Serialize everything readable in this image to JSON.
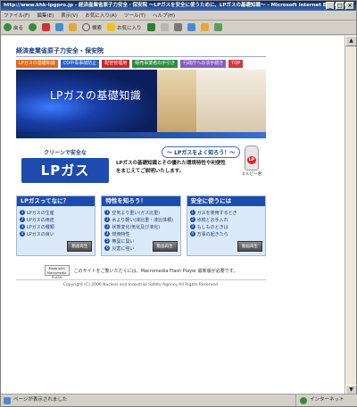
{
  "window": {
    "title": "http://www.khk-lpgpro.jp - 経済産業省原子力安全・保安院 ～LPガスを安全に使うために、LPガスの基礎知識～ - Microsoft Internet Explorer",
    "controls": [
      "_",
      "□",
      "×"
    ]
  },
  "menubar": [
    "ファイル(F)",
    "編集(E)",
    "表示(V)",
    "お気に入り(A)",
    "ツール(T)",
    "ヘルプ(H)"
  ],
  "toolbar": {
    "back": "戻る",
    "search": "検索",
    "favorites": "お気に入り"
  },
  "page": {
    "org": "経済産業省原子力安全・保安院",
    "nav": [
      {
        "label": "LPガスの基礎知識",
        "color": "#e06a1a"
      },
      {
        "label": "CO中毒事故防止",
        "color": "#2a62c9"
      },
      {
        "label": "配管管理用",
        "color": "#c62828"
      },
      {
        "label": "販売事業者の手引き",
        "color": "#2e8b3d"
      },
      {
        "label": "行政庁への法手続き",
        "color": "#8a5cc1"
      },
      {
        "label": "TOP",
        "color": "#d33a3a"
      }
    ],
    "banner_title": "LPガスの基礎知識",
    "logo_sub": "クリーンで安全な",
    "logo_main": "LPガス",
    "bubble": "～ LPガスをよく知ろう！～",
    "intro": "LPガスの基礎知識とその優れた環境特性や利便性をまじえてご説明いたします。",
    "mascot_badge": "LP",
    "mascot_name": "エルピー君",
    "sections": [
      {
        "title": "LPガスってなに？",
        "items": [
          "LPガスの生産",
          "LPガスの用途",
          "LPガスの種類",
          "LPガスの良い"
        ],
        "button": "動画再生"
      },
      {
        "title": "特性を知ろう！",
        "items": [
          "空気より重い(ガス比重)",
          "水より軽い(液比重・液比体積)",
          "状態変化(気化及び液化)",
          "燃焼特性",
          "無臭に臭い",
          "災害に強い"
        ],
        "button": "動画再生"
      },
      {
        "title": "安全に使うには",
        "items": [
          "ガスを使用するとき",
          "点検とお手入れ",
          "もしものときは",
          "万事の起きたら"
        ],
        "button": "動画再生"
      }
    ],
    "flash_badge": "Made with Macromedia FLASH",
    "flash_text": "このサイトをご覧いただくには、Macromedia Flash Player 最新版が必要です。",
    "copyright": "Copyright (C) 2006 Nuclear and Industrial Safety Agency All Rights Reserved."
  },
  "statusbar": {
    "left": "ページが表示されました",
    "right": "インターネット"
  }
}
